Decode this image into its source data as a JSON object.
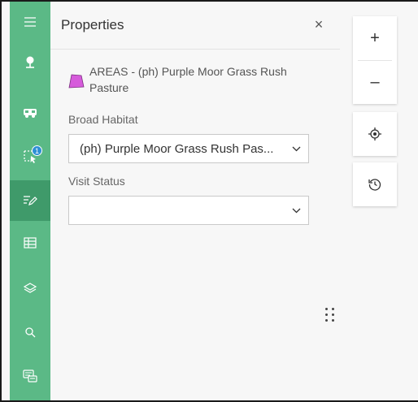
{
  "panel": {
    "title": "Properties",
    "close_label": "×",
    "feature_title": "AREAS - (ph) Purple Moor Grass Rush Pasture",
    "feature_color": "#d65bdb",
    "fields": [
      {
        "label": "Broad Habitat",
        "value": "(ph) Purple Moor Grass Rush Pas..."
      },
      {
        "label": "Visit Status",
        "value": ""
      }
    ]
  },
  "rail": {
    "items": [
      {
        "icon": "menu-icon"
      },
      {
        "icon": "map-pin-icon"
      },
      {
        "icon": "vehicle-icon"
      },
      {
        "icon": "selection-icon",
        "badge": "1"
      },
      {
        "icon": "edit-icon",
        "active": true
      },
      {
        "icon": "table-icon"
      },
      {
        "icon": "layers-icon"
      },
      {
        "icon": "search-icon"
      },
      {
        "icon": "message-icon"
      }
    ],
    "color": "#5bb986"
  },
  "map_controls": {
    "zoom_in_label": "+",
    "zoom_out_label": "–",
    "locate_icon": "locate-icon",
    "history_icon": "history-icon"
  }
}
